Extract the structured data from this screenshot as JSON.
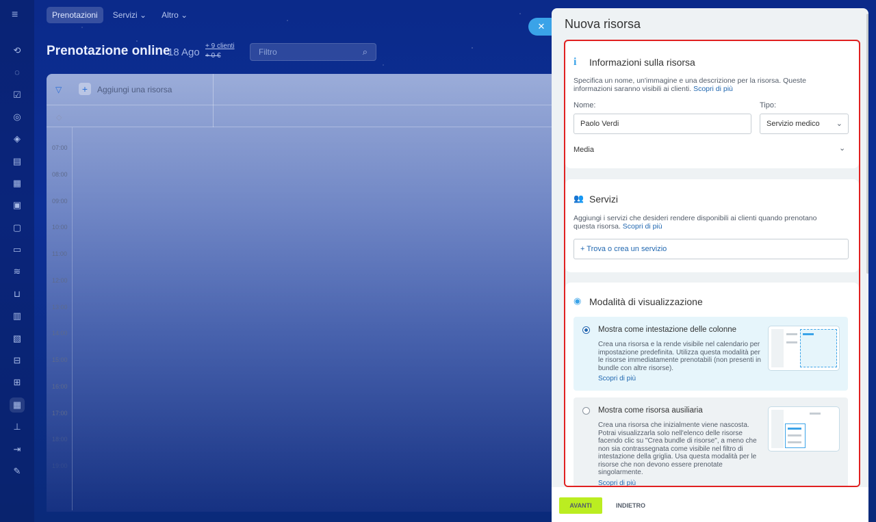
{
  "topnav": {
    "tabs": [
      "Prenotazioni",
      "Servizi ⌄",
      "Altro ⌄"
    ]
  },
  "page": {
    "title": "Prenotazione online",
    "date": "18 Ago",
    "stat_clients": "+ 9 clienti",
    "stat_money": "+ 0 €",
    "filter_placeholder": "Filtro"
  },
  "calendar": {
    "add_resource": "Aggiungi una risorsa",
    "times": [
      "07:00",
      "08:00",
      "09:00",
      "10:00",
      "11:00",
      "12:00",
      "13:00",
      "14:00",
      "15:00",
      "16:00",
      "17:00",
      "18:00",
      "19:00"
    ]
  },
  "panel": {
    "title": "Nuova risorsa",
    "info": {
      "title": "Informazioni sulla risorsa",
      "desc": "Specifica un nome, un'immagine e una descrizione per la risorsa. Queste informazioni saranno visibili ai clienti.",
      "link": "Scopri di più",
      "name_label": "Nome:",
      "name_value": "Paolo Verdi",
      "type_label": "Tipo:",
      "type_value": "Servizio medico",
      "media": "Media"
    },
    "services": {
      "title": "Servizi",
      "desc": "Aggiungi i servizi che desideri rendere disponibili ai clienti quando prenotano questa risorsa.",
      "link": "Scopri di più",
      "add": "+ Trova o crea un servizio"
    },
    "display": {
      "title": "Modalità di visualizzazione",
      "option1_title": "Mostra come intestazione delle colonne",
      "option1_desc": "Crea una risorsa e la rende visibile nel calendario per impostazione predefinita. Utilizza questa modalità per le risorse immediatamente prenotabili (non presenti in bundle con altre risorse).",
      "option1_link": "Scopri di più",
      "option2_title": "Mostra come risorsa ausiliaria",
      "option2_desc": "Crea una risorsa che inizialmente viene nascosta. Potrai visualizzarla solo nell'elenco delle risorse facendo clic su \"Crea bundle di risorse\", a meno che non sia contrassegnata come visibile nel filtro di intestazione della griglia. Usa questa modalità per le risorse che non devono essere prenotate singolarmente.",
      "option2_link": "Scopri di più"
    }
  },
  "footer": {
    "next": "AVANTI",
    "back": "INDIETRO"
  },
  "colors": {
    "accent": "#3aa3e8",
    "link": "#2067b0",
    "next_button": "#bbed21",
    "highlight_border": "#e02020"
  }
}
